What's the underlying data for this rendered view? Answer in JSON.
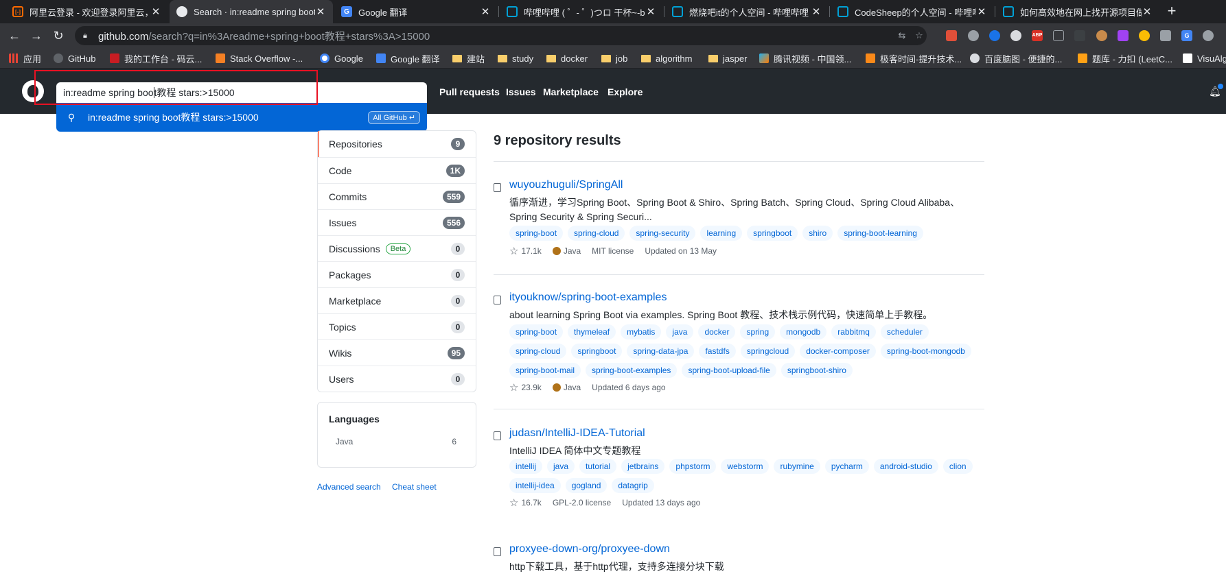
{
  "browser": {
    "tabs": [
      {
        "title": "阿里云登录 - 欢迎登录阿里云，安全稳",
        "favicon": "aliyun-icon",
        "active": false
      },
      {
        "title": "Search · in:readme spring boot",
        "favicon": "github-icon",
        "active": true
      },
      {
        "title": "Google 翻译",
        "favicon": "google-translate-icon",
        "active": false
      },
      {
        "title": "哔哩哔哩 ( ゜- ゜)つロ 干杯~-bilibili",
        "favicon": "bilibili-icon",
        "active": false
      },
      {
        "title": "燃烧吧it的个人空间 - 哔哩哔哩 ( ",
        "favicon": "bilibili-icon",
        "active": false
      },
      {
        "title": "CodeSheep的个人空间 - 哔哩哔哩",
        "favicon": "bilibili-icon",
        "active": false
      },
      {
        "title": "如何高效地在网上找开源项目做",
        "favicon": "bilibili-icon",
        "active": false
      }
    ],
    "close_glyph": "✕",
    "newtab_glyph": "+",
    "url_host": "github.com",
    "url_path": "/search?q=in%3Areadme+spring+boot教程+stars%3A>15000",
    "bookmarks": [
      {
        "label": "应用",
        "icon": "apps-icon"
      },
      {
        "label": "GitHub",
        "icon": "github-icon"
      },
      {
        "label": "我的工作台 - 码云...",
        "icon": "gitee-icon"
      },
      {
        "label": "Stack Overflow -...",
        "icon": "stackoverflow-icon"
      },
      {
        "label": "Google",
        "icon": "google-icon"
      },
      {
        "label": "Google 翻译",
        "icon": "google-translate-icon"
      },
      {
        "label": "建站",
        "icon": "folder-icon"
      },
      {
        "label": "study",
        "icon": "folder-icon"
      },
      {
        "label": "docker",
        "icon": "folder-icon"
      },
      {
        "label": "job",
        "icon": "folder-icon"
      },
      {
        "label": "algorithm",
        "icon": "folder-icon"
      },
      {
        "label": "jasper",
        "icon": "folder-icon"
      },
      {
        "label": "腾讯视频 - 中国领...",
        "icon": "tencent-video-icon"
      },
      {
        "label": "极客时间-提升技术...",
        "icon": "geektime-icon"
      },
      {
        "label": "百度脑图 - 便捷的...",
        "icon": "baidu-naotu-icon"
      },
      {
        "label": "题库 - 力扣 (LeetC...",
        "icon": "leetcode-icon"
      },
      {
        "label": "VisuAlg",
        "icon": "visualgo-icon"
      }
    ]
  },
  "github": {
    "search_value_before_caret": "in:readme spring boo",
    "search_value_after_caret": "t教程 stars:>15000",
    "suggestion_text": "in:readme spring boot教程 stars:>15000",
    "suggestion_scope": "All GitHub ↵",
    "nav": [
      "Pull requests",
      "Issues",
      "Marketplace",
      "Explore"
    ]
  },
  "filters": [
    {
      "label": "Repositories",
      "count": "9",
      "style": "dark",
      "selected": true
    },
    {
      "label": "Code",
      "count": "1K",
      "style": "dark"
    },
    {
      "label": "Commits",
      "count": "559",
      "style": "dark"
    },
    {
      "label": "Issues",
      "count": "556",
      "style": "dark"
    },
    {
      "label": "Discussions",
      "count": "0",
      "style": "grey",
      "badge": "Beta"
    },
    {
      "label": "Packages",
      "count": "0",
      "style": "grey"
    },
    {
      "label": "Marketplace",
      "count": "0",
      "style": "grey"
    },
    {
      "label": "Topics",
      "count": "0",
      "style": "grey"
    },
    {
      "label": "Wikis",
      "count": "95",
      "style": "dark"
    },
    {
      "label": "Users",
      "count": "0",
      "style": "grey"
    }
  ],
  "languages": {
    "heading": "Languages",
    "items": [
      {
        "name": "Java",
        "count": "6"
      }
    ]
  },
  "footer_links": [
    "Advanced search",
    "Cheat sheet"
  ],
  "results": {
    "heading": "9 repository results",
    "repos": [
      {
        "name": "wuyouzhuguli/SpringAll",
        "desc": "循序渐进，学习Spring Boot、Spring Boot & Shiro、Spring Batch、Spring Cloud、Spring Cloud Alibaba、Spring Security & Spring Securi...",
        "topics": [
          "spring-boot",
          "spring-cloud",
          "spring-security",
          "learning",
          "springboot",
          "shiro",
          "spring-boot-learning"
        ],
        "stars": "17.1k",
        "language": "Java",
        "license": "MIT license",
        "updated": "Updated on 13 May"
      },
      {
        "name": "ityouknow/spring-boot-examples",
        "desc": "about learning Spring Boot via examples. Spring Boot 教程、技术栈示例代码，快速简单上手教程。",
        "topics": [
          "spring-boot",
          "thymeleaf",
          "mybatis",
          "java",
          "docker",
          "spring",
          "mongodb",
          "rabbitmq",
          "scheduler",
          "spring-cloud",
          "springboot",
          "spring-data-jpa",
          "fastdfs",
          "springcloud",
          "docker-composer",
          "spring-boot-mongodb",
          "spring-boot-mail",
          "spring-boot-examples",
          "spring-boot-upload-file",
          "springboot-shiro"
        ],
        "stars": "23.9k",
        "language": "Java",
        "license": "",
        "updated": "Updated 6 days ago"
      },
      {
        "name": "judasn/IntelliJ-IDEA-Tutorial",
        "desc": "IntelliJ IDEA 简体中文专题教程",
        "topics": [
          "intellij",
          "java",
          "tutorial",
          "jetbrains",
          "phpstorm",
          "webstorm",
          "rubymine",
          "pycharm",
          "android-studio",
          "clion",
          "intellij-idea",
          "gogland",
          "datagrip"
        ],
        "stars": "16.7k",
        "language": "",
        "license": "GPL-2.0 license",
        "updated": "Updated 13 days ago"
      },
      {
        "name": "proxyee-down-org/proxyee-down",
        "desc": "http下载工具，基于http代理，支持多连接分块下载",
        "topics": [],
        "stars": "",
        "language": "",
        "license": "",
        "updated": ""
      }
    ]
  },
  "colors": {
    "accent": "#0366d6",
    "header": "#24292e",
    "highlight_box": "#e81123",
    "java": "#b07219"
  }
}
